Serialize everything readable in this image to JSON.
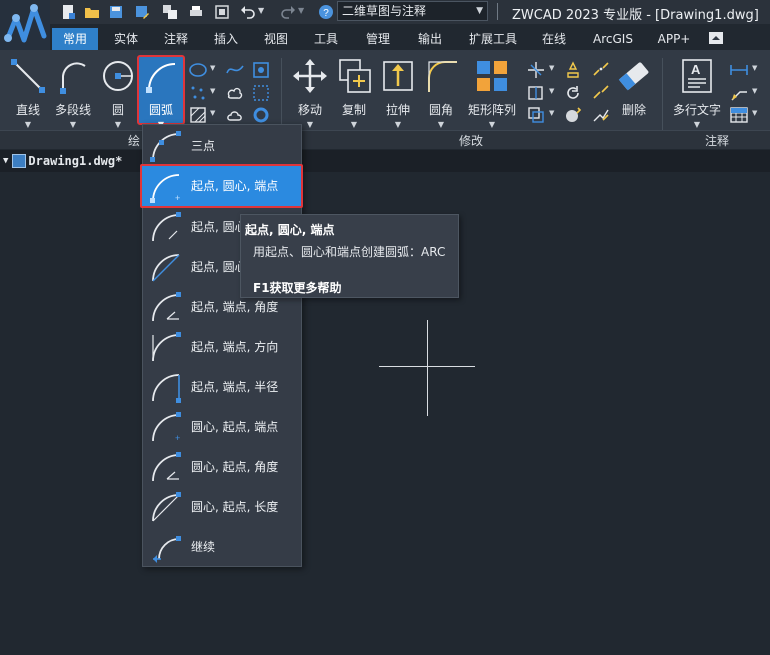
{
  "title_bar": {
    "workspace": "二维草图与注释",
    "title": "ZWCAD 2023 专业版 - [Drawing1.dwg]"
  },
  "tabs": [
    "常用",
    "实体",
    "注释",
    "插入",
    "视图",
    "工具",
    "管理",
    "输出",
    "扩展工具",
    "在线",
    "ArcGIS",
    "APP+"
  ],
  "active_tab": "常用",
  "ribbon": {
    "buttons": {
      "line": "直线",
      "polyline": "多段线",
      "circle": "圆",
      "arc": "圆弧",
      "move": "移动",
      "copy": "复制",
      "stretch": "拉伸",
      "fillet": "圆角",
      "rect_array": "矩形阵列",
      "erase": "删除",
      "mtext": "多行文字"
    },
    "panels": {
      "draw": "绘",
      "modify": "修改",
      "annotate": "注释"
    }
  },
  "document_tab": "Drawing1.dwg*",
  "arc_menu": [
    {
      "label": "三点",
      "icon": "arc-3point-icon"
    },
    {
      "label": "起点, 圆心, 端点",
      "icon": "arc-start-center-end-icon",
      "highlighted": true
    },
    {
      "label": "起点, 圆心, 角度",
      "icon": "arc-start-center-angle-icon"
    },
    {
      "label": "起点, 圆心, 长度",
      "icon": "arc-start-center-length-icon"
    },
    {
      "label": "起点, 端点, 角度",
      "icon": "arc-start-end-angle-icon"
    },
    {
      "label": "起点, 端点, 方向",
      "icon": "arc-start-end-direction-icon"
    },
    {
      "label": "起点, 端点, 半径",
      "icon": "arc-start-end-radius-icon"
    },
    {
      "label": "圆心, 起点, 端点",
      "icon": "arc-center-start-end-icon"
    },
    {
      "label": "圆心, 起点, 角度",
      "icon": "arc-center-start-angle-icon"
    },
    {
      "label": "圆心, 起点, 长度",
      "icon": "arc-center-start-length-icon"
    },
    {
      "label": "继续",
      "icon": "arc-continue-icon"
    }
  ],
  "tooltip": {
    "title": "起点, 圆心, 端点",
    "description": "用起点、圆心和端点创建圆弧：ARC",
    "help": "F1获取更多帮助"
  },
  "colors": {
    "accent": "#2f80c9",
    "highlight_border": "#e0353a",
    "canvas": "#212830"
  }
}
